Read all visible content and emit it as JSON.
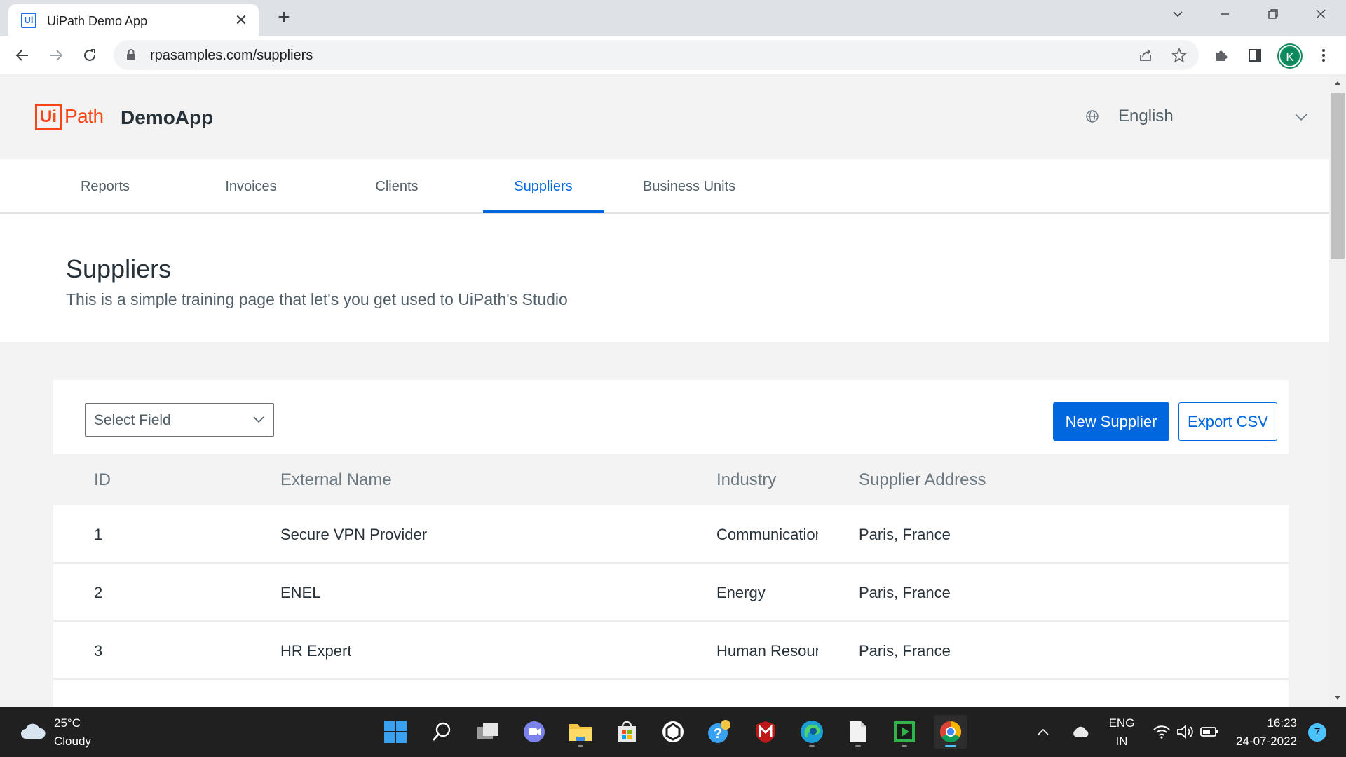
{
  "browser": {
    "tab_title": "UiPath Demo App",
    "tab_favicon": "Ui",
    "url": "rpasamples.com/suppliers",
    "profile_initial": "K"
  },
  "app": {
    "logo_box": "Ui",
    "logo_path": "Path",
    "app_name": "DemoApp",
    "language": "English"
  },
  "nav": {
    "items": [
      "Reports",
      "Invoices",
      "Clients",
      "Suppliers",
      "Business Units"
    ],
    "active": "Suppliers"
  },
  "page": {
    "title": "Suppliers",
    "description": "This is a simple training page that let's you get used to UiPath's Studio"
  },
  "controls": {
    "select_placeholder": "Select Field",
    "new_button": "New Supplier",
    "export_button": "Export CSV"
  },
  "table": {
    "headers": [
      "ID",
      "External Name",
      "Industry",
      "Supplier Address"
    ],
    "rows": [
      [
        "1",
        "Secure VPN Provider",
        "Communications",
        "Paris, France"
      ],
      [
        "2",
        "ENEL",
        "Energy",
        "Paris, France"
      ],
      [
        "3",
        "HR Expert",
        "Human Resources",
        "Paris, France"
      ]
    ]
  },
  "taskbar": {
    "temperature": "25°C",
    "condition": "Cloudy",
    "lang_line1": "ENG",
    "lang_line2": "IN",
    "time": "16:23",
    "date": "24-07-2022",
    "notifications": "7"
  },
  "colors": {
    "accent": "#0067df",
    "brand": "#fa4616",
    "text_dark": "#273139",
    "text_muted": "#526069"
  }
}
